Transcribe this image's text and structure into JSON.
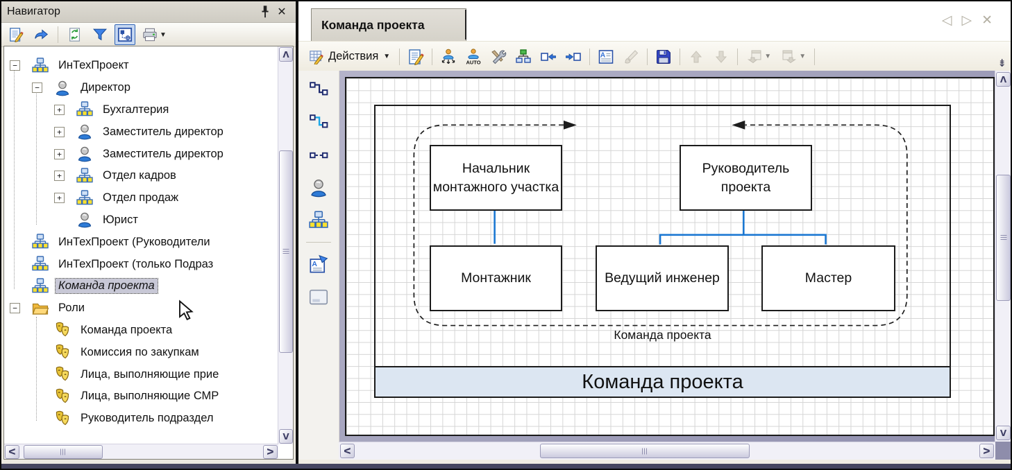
{
  "navigator": {
    "title": "Навигатор",
    "titlebar_icons": [
      "pin-icon",
      "close-icon"
    ],
    "toolbar_icons": [
      "edit-icon",
      "redo-icon",
      "refresh-icon",
      "filter-icon",
      "sync-window-icon",
      "printer-icon"
    ],
    "tree": {
      "items": [
        {
          "label": "ИнТехПроект",
          "icon": "orgchart",
          "level": 0,
          "expander": "-",
          "selected": false
        },
        {
          "label": "Директор",
          "icon": "person",
          "level": 1,
          "expander": "-",
          "selected": false
        },
        {
          "label": "Бухгалтерия",
          "icon": "orgchart",
          "level": 2,
          "expander": "+",
          "selected": false
        },
        {
          "label": "Заместитель директор",
          "icon": "person",
          "level": 2,
          "expander": "+",
          "selected": false
        },
        {
          "label": "Заместитель директор",
          "icon": "person",
          "level": 2,
          "expander": "+",
          "selected": false
        },
        {
          "label": "Отдел кадров",
          "icon": "orgchart",
          "level": 2,
          "expander": "+",
          "selected": false
        },
        {
          "label": "Отдел продаж",
          "icon": "orgchart",
          "level": 2,
          "expander": "+",
          "selected": false
        },
        {
          "label": "Юрист",
          "icon": "person",
          "level": 2,
          "expander": "",
          "selected": false
        },
        {
          "label": "ИнТехПроект (Руководители",
          "icon": "orgchart",
          "level": 0,
          "expander": "",
          "selected": false
        },
        {
          "label": "ИнТехПроект (только Подраз",
          "icon": "orgchart",
          "level": 0,
          "expander": "",
          "selected": false
        },
        {
          "label": "Команда проекта",
          "icon": "orgchart",
          "level": 0,
          "expander": "",
          "selected": true
        },
        {
          "label": "Роли",
          "icon": "folder",
          "level": 0,
          "expander": "-",
          "selected": false
        },
        {
          "label": "Команда проекта",
          "icon": "mask",
          "level": 1,
          "expander": "",
          "selected": false
        },
        {
          "label": "Комиссия по закупкам",
          "icon": "mask",
          "level": 1,
          "expander": "",
          "selected": false
        },
        {
          "label": "Лица, выполняющие прие",
          "icon": "mask",
          "level": 1,
          "expander": "",
          "selected": false
        },
        {
          "label": "Лица, выполняющие СМР",
          "icon": "mask",
          "level": 1,
          "expander": "",
          "selected": false
        },
        {
          "label": "Руководитель подраздел",
          "icon": "mask",
          "level": 1,
          "expander": "",
          "selected": false
        }
      ]
    }
  },
  "editor": {
    "tab_label": "Команда проекта",
    "tabnav_icons": [
      "prev-tab-icon",
      "next-tab-icon",
      "close-tab-icon"
    ],
    "tabnav_glyphs": {
      "prev": "◁",
      "next": "▷",
      "close": "✕"
    },
    "actions_label": "Действия",
    "toolbar_icons": [
      "actions-grid-icon",
      "edit-icon",
      "layout-subordinates-icon",
      "auto-layout-icon",
      "settings-tools-icon",
      "orgchart-assign-icon",
      "insert-before-icon",
      "insert-after-icon",
      "text-block-icon",
      "format-brush-icon",
      "save-icon",
      "move-up-icon",
      "move-down-icon",
      "import-window-icon",
      "export-window-icon",
      "toolbar-overflow-icon"
    ],
    "stencil_icons": [
      "connector-dark-icon",
      "connector-blue-icon",
      "connector-dashed-icon",
      "position-person-icon",
      "department-orgchart-icon",
      "text-callout-icon",
      "frame-title-icon"
    ]
  },
  "diagram": {
    "boxes": [
      {
        "id": "nachalnik",
        "label": "Начальник монтажного участка"
      },
      {
        "id": "rukovoditel",
        "label": "Руководитель проекта"
      },
      {
        "id": "montazhnik",
        "label": "Монтажник"
      },
      {
        "id": "vedushchiy",
        "label": "Ведущий инженер"
      },
      {
        "id": "master",
        "label": "Мастер"
      }
    ],
    "edges": [
      {
        "from": "nachalnik",
        "to": "montazhnik"
      },
      {
        "from": "rukovoditel",
        "to": "vedushchiy"
      },
      {
        "from": "rukovoditel",
        "to": "master"
      }
    ],
    "group_label": "Команда проекта",
    "frame_title": "Команда проекта"
  },
  "colors": {
    "connector": "#1a77d2",
    "frame_title_bg": "#dce6f2",
    "canvas_surround": "#908fae",
    "selection_bg": "#c8c8d6",
    "grid_line": "#d5d5d5"
  }
}
